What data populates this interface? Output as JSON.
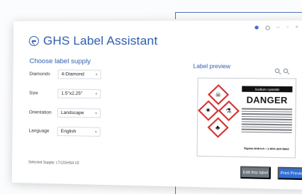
{
  "app": {
    "title": "GHS Label Assistant"
  },
  "form": {
    "section_title": "Choose label supply",
    "rows": [
      {
        "label": "Diamonds",
        "value": "4-Diamond"
      },
      {
        "label": "Size",
        "value": "1.5\"x2.25\""
      },
      {
        "label": "Orientation",
        "value": "Landscape"
      },
      {
        "label": "Language",
        "value": "English"
      }
    ],
    "selected_supply": "Selected Supply: LT12GHS4 V2"
  },
  "preview": {
    "title": "Label preview",
    "chemical_name": "Sodium cyanide",
    "signal_word": "DANGER",
    "supplier_name": "Sigma-Aldrich • 1-800-325-5832",
    "pictograms": [
      "skull-crossbones-icon",
      "health-hazard-icon",
      "corrosion-icon",
      "environment-icon"
    ]
  },
  "buttons": {
    "edit_label": "Edit this label",
    "print_label": "Print Preview"
  },
  "colors": {
    "accent": "#2e5dae",
    "danger": "#d32c2c",
    "print_button": "#2f6ed8",
    "edit_button": "#6e7780"
  }
}
